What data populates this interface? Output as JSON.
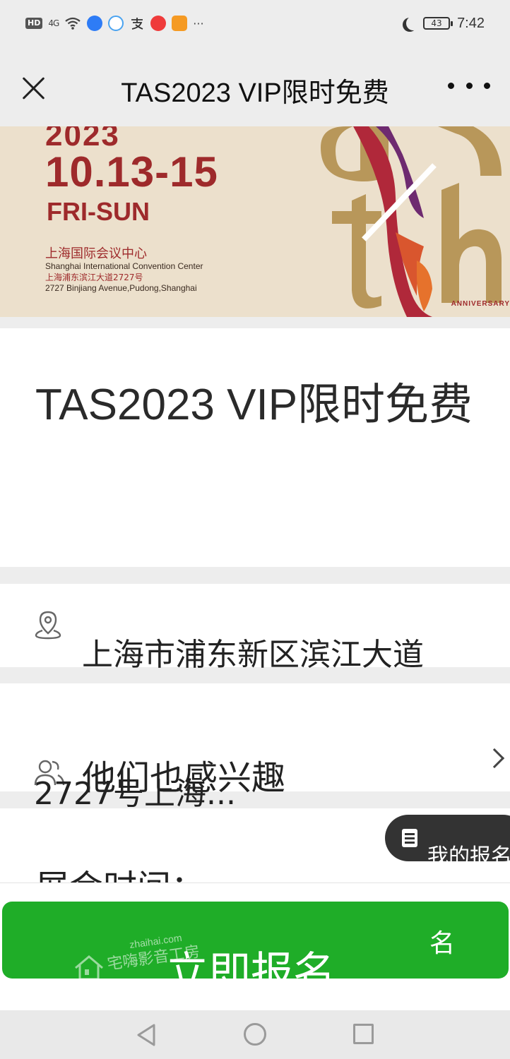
{
  "status_bar": {
    "hd": "HD",
    "signal": "4G",
    "more": "···",
    "battery": "43",
    "time": "7:42"
  },
  "nav": {
    "title": "TAS2023 VIP限时免费"
  },
  "banner": {
    "year": "2023",
    "dates": "10.13-15",
    "days": "FRI-SUN",
    "venue_cn": "上海国际会议中心",
    "venue_en": "Shanghai International Convention Center",
    "address_cn": "上海浦东滨江大道2727号",
    "address_en": "2727 Binjiang Avenue,Pudong,Shanghai",
    "anniversary": "ANNIVERSARY"
  },
  "event": {
    "title": "TAS2023 VIP限时免费",
    "address_line1": "上海市浦东新区滨江大道",
    "address_line2": "2727号上海...",
    "interest_label": "他们也感兴趣",
    "time_label": "展会时间："
  },
  "my_registration": {
    "label": "我的报名"
  },
  "signup": {
    "label": "立即报名",
    "extra": "名"
  },
  "watermark": {
    "url": "zhaihai.com",
    "text": "宅嗨影音工房"
  },
  "colors": {
    "accent_green": "#1fad28",
    "banner_red": "#9e2a2b",
    "banner_gold": "#b8975a",
    "banner_bg": "#ece0cc"
  }
}
